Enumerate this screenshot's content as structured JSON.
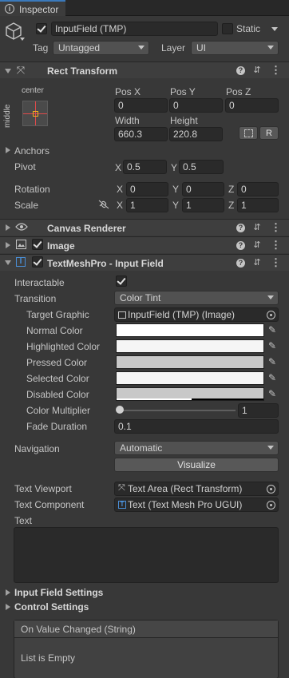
{
  "tab": {
    "label": "Inspector"
  },
  "object": {
    "name": "InputField (TMP)",
    "static_label": "Static",
    "tag_label": "Tag",
    "tag_value": "Untagged",
    "layer_label": "Layer",
    "layer_value": "UI"
  },
  "rect_transform": {
    "title": "Rect Transform",
    "anchor_h": "center",
    "anchor_v": "middle",
    "pos_x_label": "Pos X",
    "pos_y_label": "Pos Y",
    "pos_z_label": "Pos Z",
    "pos_x": "0",
    "pos_y": "0",
    "pos_z": "0",
    "width_label": "Width",
    "height_label": "Height",
    "width": "660.3",
    "height": "220.8",
    "r_button": "R",
    "anchors_label": "Anchors",
    "pivot_label": "Pivot",
    "pivot_x": "0.5",
    "pivot_y": "0.5",
    "rotation_label": "Rotation",
    "rot_x": "0",
    "rot_y": "0",
    "rot_z": "0",
    "scale_label": "Scale",
    "scale_x": "1",
    "scale_y": "1",
    "scale_z": "1",
    "x": "X",
    "y": "Y",
    "z": "Z"
  },
  "components": {
    "canvas_renderer": "Canvas Renderer",
    "image": "Image",
    "input_field": "TextMeshPro - Input Field"
  },
  "input_field": {
    "interactable_label": "Interactable",
    "transition_label": "Transition",
    "transition_value": "Color Tint",
    "target_graphic_label": "Target Graphic",
    "target_graphic_value": "InputField (TMP) (Image)",
    "normal_color_label": "Normal Color",
    "highlighted_color_label": "Highlighted Color",
    "pressed_color_label": "Pressed Color",
    "selected_color_label": "Selected Color",
    "disabled_color_label": "Disabled Color",
    "color_multiplier_label": "Color Multiplier",
    "color_multiplier_value": "1",
    "fade_duration_label": "Fade Duration",
    "fade_duration_value": "0.1",
    "navigation_label": "Navigation",
    "navigation_value": "Automatic",
    "visualize_button": "Visualize",
    "text_viewport_label": "Text Viewport",
    "text_viewport_value": "Text Area (Rect Transform)",
    "text_component_label": "Text Component",
    "text_component_value": "Text (Text Mesh Pro UGUI)",
    "text_label": "Text",
    "input_field_settings": "Input Field Settings",
    "control_settings": "Control Settings",
    "event_title": "On Value Changed (String)",
    "event_empty": "List is Empty"
  },
  "colors": {
    "normal": "#ffffff",
    "highlighted": "#f5f5f5",
    "pressed": "#c8c8c8",
    "selected": "#f5f5f5",
    "disabled": "#c8c8c8",
    "accent": "#3a79bb"
  }
}
